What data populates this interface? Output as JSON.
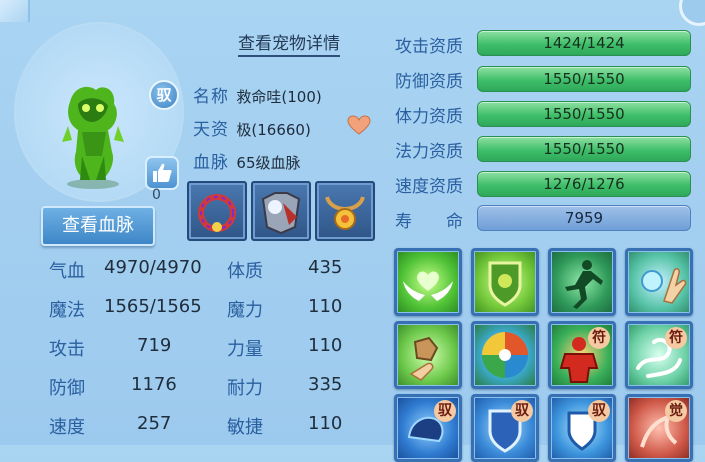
{
  "pet": {
    "detail_link": "查看宠物详情",
    "bind_mark": "驭",
    "likes": "0",
    "name_label": "名称",
    "name_value": "救命哇(100)",
    "aptitude_label": "天资",
    "aptitude_value": "极(16660)",
    "bloodline_label": "血脉",
    "bloodline_value": "65级血脉",
    "view_bloodline_button": "查看血脉"
  },
  "stats": [
    {
      "label": "气血",
      "value": "4970/4970",
      "label2": "体质",
      "value2": "435"
    },
    {
      "label": "魔法",
      "value": "1565/1565",
      "label2": "魔力",
      "value2": "110"
    },
    {
      "label": "攻击",
      "value": "719",
      "label2": "力量",
      "value2": "110"
    },
    {
      "label": "防御",
      "value": "1176",
      "label2": "耐力",
      "value2": "335"
    },
    {
      "label": "速度",
      "value": "257",
      "label2": "敏捷",
      "value2": "110"
    }
  ],
  "aptitudes": [
    {
      "label": "攻击资质",
      "value": "1424/1424"
    },
    {
      "label": "防御资质",
      "value": "1550/1550"
    },
    {
      "label": "体力资质",
      "value": "1550/1550"
    },
    {
      "label": "法力资质",
      "value": "1550/1550"
    },
    {
      "label": "速度资质",
      "value": "1276/1276"
    }
  ],
  "life": {
    "label": "寿　　命",
    "value": "7959"
  },
  "skills": [
    {
      "icon": "green-wings-heart-icon",
      "tag": ""
    },
    {
      "icon": "green-shield-icon",
      "tag": ""
    },
    {
      "icon": "green-runner-icon",
      "tag": ""
    },
    {
      "icon": "green-hand-orb-icon",
      "tag": ""
    },
    {
      "icon": "rock-hand-icon",
      "tag": ""
    },
    {
      "icon": "elemental-orb-icon",
      "tag": ""
    },
    {
      "icon": "red-warrior-icon",
      "tag": "符"
    },
    {
      "icon": "green-whirl-icon",
      "tag": "符"
    },
    {
      "icon": "blue-beast-icon",
      "tag": "驭"
    },
    {
      "icon": "blue-shield-icon",
      "tag": "驭"
    },
    {
      "icon": "blue-shield-2-icon",
      "tag": "驭"
    },
    {
      "icon": "red-awaken-icon",
      "tag": "觉"
    }
  ],
  "colors": {
    "accent": "#2a5fa0",
    "green_bar": "#3fbf6a",
    "life_bar": "#6f9fd8"
  }
}
